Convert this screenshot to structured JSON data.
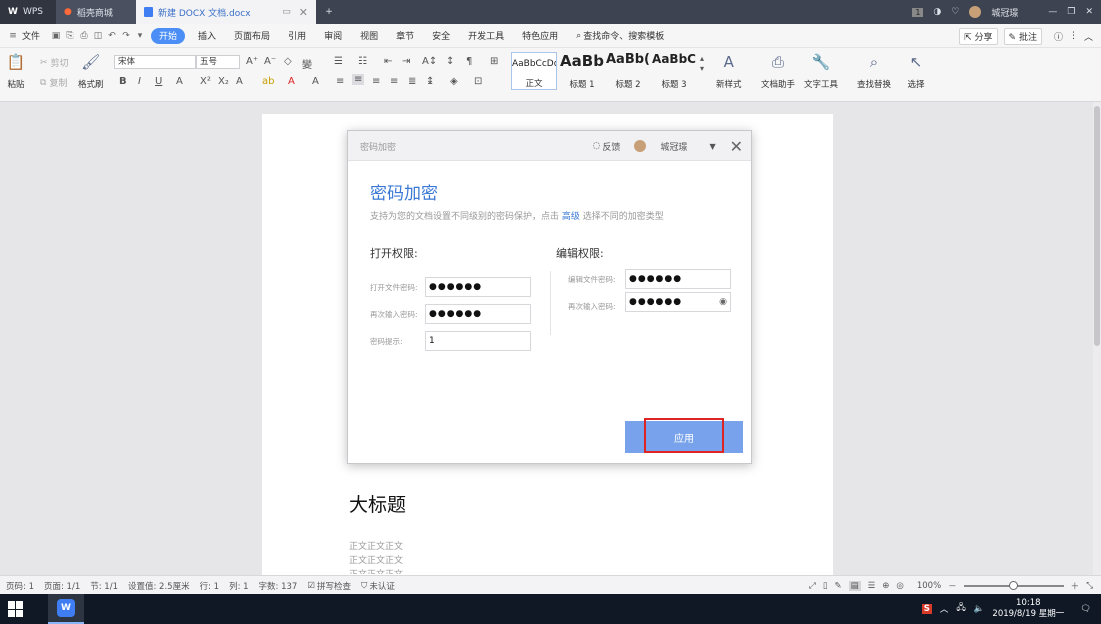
{
  "titlebar": {
    "tabs": [
      {
        "label": "WPS",
        "icon": "wps-logo-icon"
      },
      {
        "label": "稻壳商城",
        "icon": "flame-icon"
      },
      {
        "label": "新建 DOCX 文档.docx",
        "icon": "doc-icon"
      }
    ],
    "badge": "1",
    "user": "城冠璟"
  },
  "menubar": {
    "file": "文件",
    "items": [
      "开始",
      "插入",
      "页面布局",
      "引用",
      "审阅",
      "视图",
      "章节",
      "安全",
      "开发工具",
      "特色应用"
    ],
    "active": "开始",
    "search": "查找命令、搜索模板",
    "share": "分享",
    "comment": "批注"
  },
  "ribbon": {
    "paste": "粘贴",
    "cut": "剪切",
    "copy": "复制",
    "format_painter": "格式刷",
    "font_name": "宋体",
    "font_size": "五号",
    "styles": [
      {
        "preview": "AaBbCcDd",
        "label": "正文"
      },
      {
        "preview": "AaBb",
        "label": "标题 1"
      },
      {
        "preview": "AaBb(",
        "label": "标题 2"
      },
      {
        "preview": "AaBbC",
        "label": "标题 3"
      }
    ],
    "new_style": "新样式",
    "doc_assistant": "文档助手",
    "text_tools": "文字工具",
    "find_replace": "查找替换",
    "select": "选择"
  },
  "dialog": {
    "window_title": "密码加密",
    "feedback": "反馈",
    "user": "城冠璟",
    "title": "密码加密",
    "desc_before": "支持为您的文档设置不同级别的密码保护，点击",
    "desc_link": "高级",
    "desc_after": "选择不同的加密类型",
    "open_section": "打开权限:",
    "edit_section": "编辑权限:",
    "open_password_label": "打开文件密码:",
    "open_password_value": "●●●●●●",
    "open_confirm_label": "再次输入密码:",
    "open_confirm_value": "●●●●●●",
    "hint_label": "密码提示:",
    "hint_value": "1",
    "edit_password_label": "编辑文件密码:",
    "edit_password_value": "●●●●●●",
    "edit_confirm_label": "再次输入密码:",
    "edit_confirm_value": "●●●●●●",
    "apply": "应用"
  },
  "document": {
    "heading": "大标题",
    "body_lines": [
      "正文正文正文",
      "正文正文正文",
      "正文正文正文"
    ]
  },
  "statusbar": {
    "page_code": "页码: 1",
    "page": "页面: 1/1",
    "section": "节: 1/1",
    "setting": "设置值: 2.5厘米",
    "row": "行: 1",
    "col": "列: 1",
    "word_count": "字数: 137",
    "spell_check": "拼写检查",
    "cert": "未认证",
    "zoom": "100%",
    "zoom_level": 0.5
  },
  "taskbar": {
    "time": "10:18",
    "date": "2019/8/19 星期一"
  },
  "colors": {
    "accent": "#4b8ff6",
    "dialog_title": "#3a78d4",
    "apply_button": "#78a3ec",
    "highlight": "#e02323"
  }
}
